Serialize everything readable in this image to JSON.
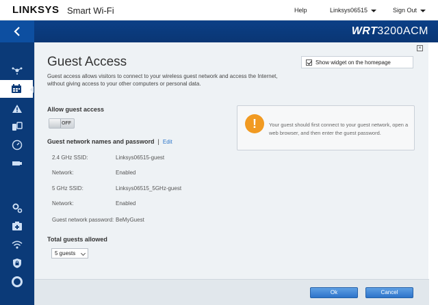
{
  "header": {
    "logo": "LINKSYS",
    "product": "Smart Wi-Fi",
    "help": "Help",
    "account": "Linksys06515",
    "signout": "Sign Out"
  },
  "band": {
    "model_prefix": "WRT",
    "model_suffix": "3200ACM"
  },
  "sidebar": {
    "items": [
      {
        "icon": "network-map-icon",
        "active": false
      },
      {
        "icon": "guest-access-icon",
        "active": true
      },
      {
        "icon": "alert-icon",
        "active": false
      },
      {
        "icon": "devices-icon",
        "active": false
      },
      {
        "icon": "speed-test-icon",
        "active": false
      },
      {
        "icon": "usb-storage-icon",
        "active": false
      },
      {
        "icon": "settings-gear-icon",
        "active": false
      },
      {
        "icon": "troubleshooting-icon",
        "active": false
      },
      {
        "icon": "wireless-icon",
        "active": false
      },
      {
        "icon": "security-lock-icon",
        "active": false
      },
      {
        "icon": "support-icon",
        "active": false
      }
    ]
  },
  "page": {
    "title": "Guest Access",
    "description": "Guest access allows visitors to connect to your wireless guest network and access the Internet, without giving access to your other computers or personal data.",
    "widget_label": "Show widget on the homepage",
    "widget_checked": true,
    "allow_label": "Allow guest access",
    "toggle_state": "OFF",
    "names_heading": "Guest network names and password",
    "names_sep": "|",
    "edit_link": "Edit",
    "fields": [
      {
        "label": "2.4 GHz SSID:",
        "value": "Linksys06515-guest"
      },
      {
        "label": "Network:",
        "value": "Enabled"
      },
      {
        "label": "5 GHz SSID:",
        "value": "Linksys06515_5GHz-guest"
      },
      {
        "label": "Network:",
        "value": "Enabled"
      },
      {
        "label": "Guest network password:",
        "value": "BeMyGuest"
      }
    ],
    "total_label": "Total guests allowed",
    "total_value": "5 guests",
    "notice": "Your guest should first connect to your guest network, open a web browser, and then enter the guest password.",
    "ok_label": "Ok",
    "cancel_label": "Cancel"
  },
  "colors": {
    "accent_blue": "#0b3a78",
    "warning_orange": "#f19a22",
    "button_blue": "#2d73c9"
  }
}
